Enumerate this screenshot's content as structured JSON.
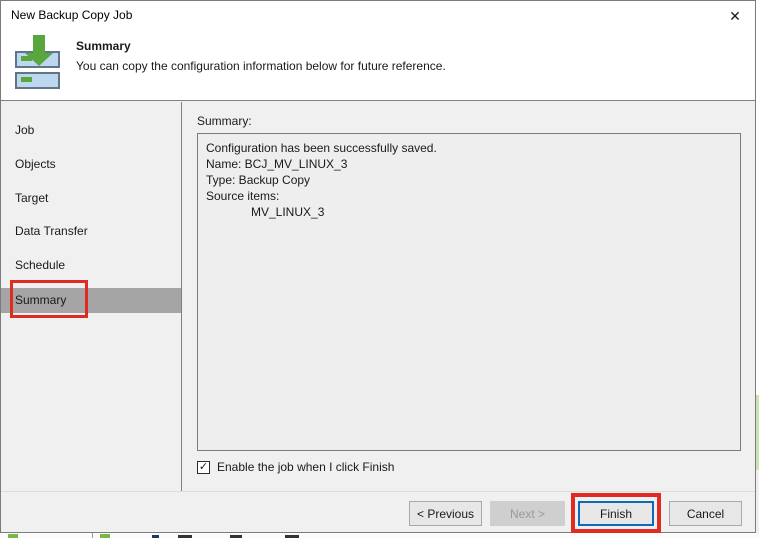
{
  "window": {
    "title": "New Backup Copy Job",
    "close_icon": "✕"
  },
  "header": {
    "title": "Summary",
    "description": "You can copy the configuration information below for future reference.",
    "icon": "backup-copy-job-icon"
  },
  "sidebar": {
    "items": [
      {
        "label": "Job",
        "selected": false
      },
      {
        "label": "Objects",
        "selected": false
      },
      {
        "label": "Target",
        "selected": false
      },
      {
        "label": "Data Transfer",
        "selected": false
      },
      {
        "label": "Schedule",
        "selected": false
      },
      {
        "label": "Summary",
        "selected": true
      }
    ]
  },
  "main": {
    "summary_label": "Summary:",
    "summary_lines": {
      "line1": "Configuration has been successfully saved.",
      "line2": "Name: BCJ_MV_LINUX_3",
      "line3": "Type: Backup Copy",
      "line4": "Source items:",
      "line5": "MV_LINUX_3"
    },
    "checkbox": {
      "label": "Enable the job when I click Finish",
      "checked": true,
      "check_glyph": "✓"
    }
  },
  "footer": {
    "previous": "< Previous",
    "next": "Next >",
    "finish": "Finish",
    "cancel": "Cancel"
  },
  "colors": {
    "annotation_red": "#e02b20",
    "selected_step_gray": "#a5a5a5",
    "focus_blue": "#0f69b4",
    "icon_green": "#5aa63e",
    "icon_blue_fill": "#bdd7ee",
    "dialog_body": "#f0f0f0",
    "disabled_button_bg": "#cfcfcf"
  }
}
